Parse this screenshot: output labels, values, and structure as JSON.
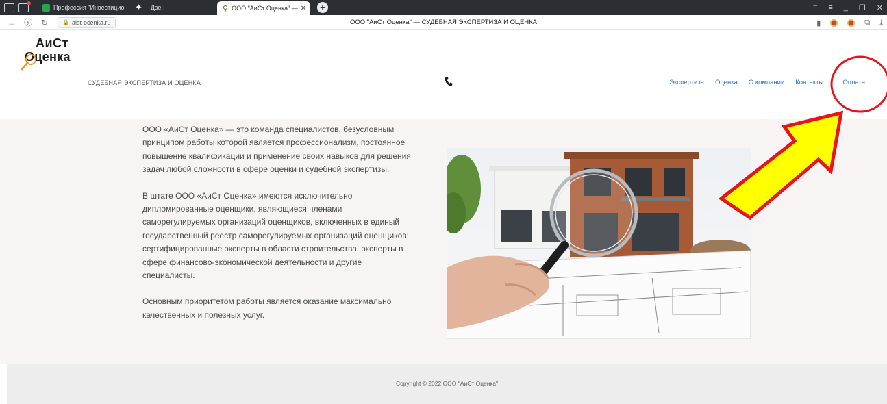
{
  "browser": {
    "tabs": [
      {
        "label": "Профессия \"Инвестицио"
      },
      {
        "label": "Дзен"
      },
      {
        "label": "ООО \"АиСт Оценка\" — "
      }
    ],
    "url": "aist-ocenka.ru",
    "page_title": "ООО \"АиСт Оценка\" — СУДЕБНАЯ ЭКСПЕРТИЗА И ОЦЕНКА"
  },
  "site": {
    "logo_line1": "АиСт",
    "logo_line2": "Оценка",
    "tagline": "СУДЕБНАЯ ЭКСПЕРТИЗА И ОЦЕНКА",
    "nav": [
      {
        "label": "Экспертиза"
      },
      {
        "label": "Оценка"
      },
      {
        "label": "О компании"
      },
      {
        "label": "Контакты"
      },
      {
        "label": "Оплата"
      }
    ]
  },
  "content": {
    "paragraphs": [
      "ООО «АиСт Оценка» — это команда специалистов, безусловным принципом работы которой является профессионализм, постоянное повышение квалификации и применение своих навыков для решения задач любой сложности в сфере оценки и судебной экспертизы.",
      "В штате ООО «АиСт Оценка» имеются исключительно дипломированные оценщики, являющиеся членами саморегулируемых организаций оценщиков, включенных в единый государственный реестр саморегулируемых организаций оценщиков: сертифицированные эксперты в области строительства, эксперты в сфере финансово-экономической деятельности и другие специалисты.",
      "Основным приоритетом работы является оказание максимально качественных и полезных услуг."
    ]
  },
  "footer": {
    "copyright": "Copyright © 2022 ООО \"АиСт Оценка\""
  },
  "colors": {
    "nav_link": "#2d74c4",
    "content_bg": "#f8f4f4",
    "footer_bg": "#ededed",
    "annotation_red": "#e8141b",
    "annotation_yellow": "#ffff00"
  }
}
